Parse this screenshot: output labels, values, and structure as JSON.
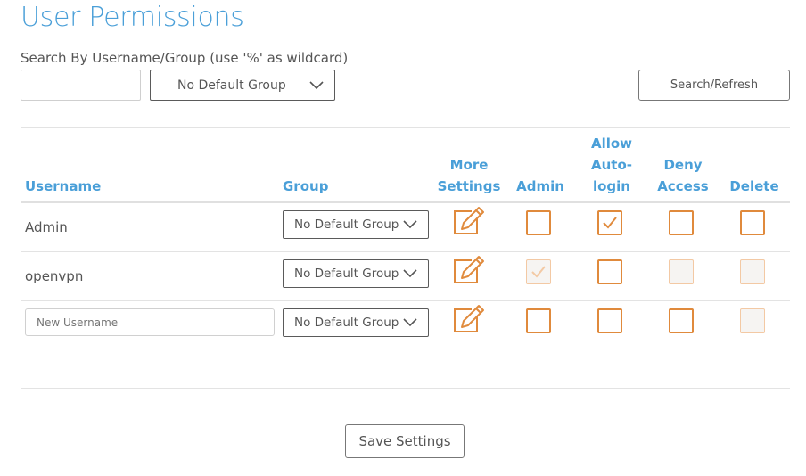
{
  "page": {
    "title": "User Permissions"
  },
  "search": {
    "label": "Search By Username/Group (use '%' as wildcard)",
    "value": "",
    "group_selected": "No Default Group",
    "button_label": "Search/Refresh"
  },
  "columns": {
    "username": "Username",
    "group": "Group",
    "more_settings": [
      "More",
      "Settings"
    ],
    "admin": "Admin",
    "allow_autologin": [
      "Allow",
      "Auto-",
      "login"
    ],
    "deny_access": [
      "Deny",
      "Access"
    ],
    "delete": "Delete"
  },
  "rows": [
    {
      "username": "Admin",
      "group": "No Default Group",
      "admin": false,
      "autologin": true,
      "deny": false,
      "delete": false,
      "admin_disabled": false,
      "deny_disabled": false,
      "delete_disabled": false
    },
    {
      "username": "openvpn",
      "group": "No Default Group",
      "admin": true,
      "autologin": false,
      "deny": false,
      "delete": false,
      "admin_disabled": true,
      "deny_disabled": true,
      "delete_disabled": true
    },
    {
      "username": "",
      "username_placeholder": "New Username",
      "group": "No Default Group",
      "admin": false,
      "autologin": false,
      "deny": false,
      "delete": false,
      "admin_disabled": false,
      "deny_disabled": false,
      "delete_disabled": true
    }
  ],
  "save_button": "Save Settings",
  "colors": {
    "accent": "#4a9fd8",
    "checkbox": "#e08a3c",
    "checkbox_disabled": "#f3c9a4"
  }
}
